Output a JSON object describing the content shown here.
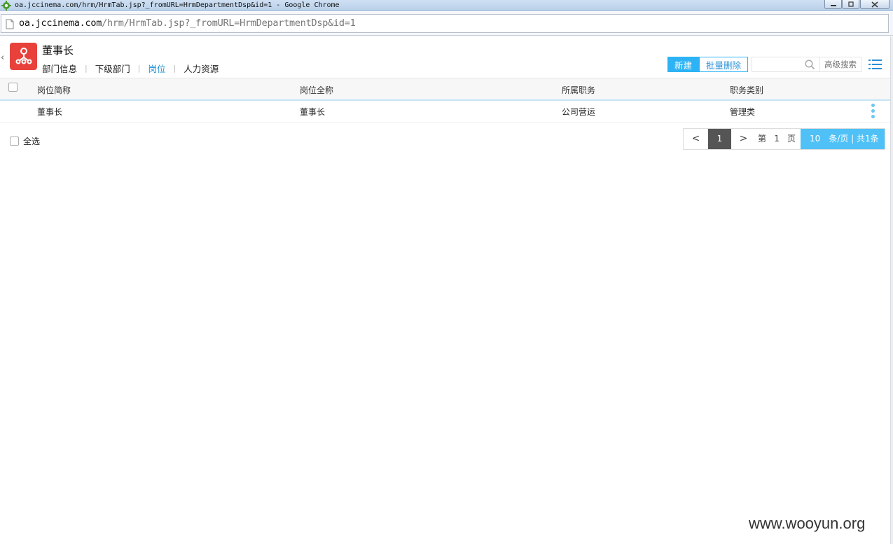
{
  "window": {
    "title": "oa.jccinema.com/hrm/HrmTab.jsp?_fromURL=HrmDepartmentDsp&id=1 - Google Chrome"
  },
  "address_bar": {
    "host": "oa.jccinema.com",
    "path": "/hrm/HrmTab.jsp?_fromURL=HrmDepartmentDsp&id=1"
  },
  "header": {
    "title": "董事长",
    "tabs": [
      {
        "label": "部门信息",
        "active": false
      },
      {
        "label": "下级部门",
        "active": false
      },
      {
        "label": "岗位",
        "active": true
      },
      {
        "label": "人力资源",
        "active": false
      }
    ]
  },
  "toolbar": {
    "new_label": "新建",
    "batch_delete_label": "批量删除",
    "search_placeholder": "",
    "advanced_search_label": "高级搜索"
  },
  "table": {
    "columns": [
      "岗位简称",
      "岗位全称",
      "所属职务",
      "职务类别"
    ],
    "rows": [
      [
        "董事长",
        "董事长",
        "公司营运",
        "管理类"
      ]
    ]
  },
  "footer": {
    "select_all_label": "全选",
    "pager": {
      "prev": "<",
      "current_page": "1",
      "next": ">",
      "page_prefix": "第",
      "page_input": "1",
      "page_suffix": "页",
      "page_size": "10",
      "page_size_suffix": "条/页 | 共1条"
    }
  },
  "watermark": "www.wooyun.org",
  "colors": {
    "accent": "#2db3f5",
    "active_tab": "#1e90d6",
    "dept_icon": "#e8413b",
    "pager_size_bg": "#4fc1f7"
  }
}
